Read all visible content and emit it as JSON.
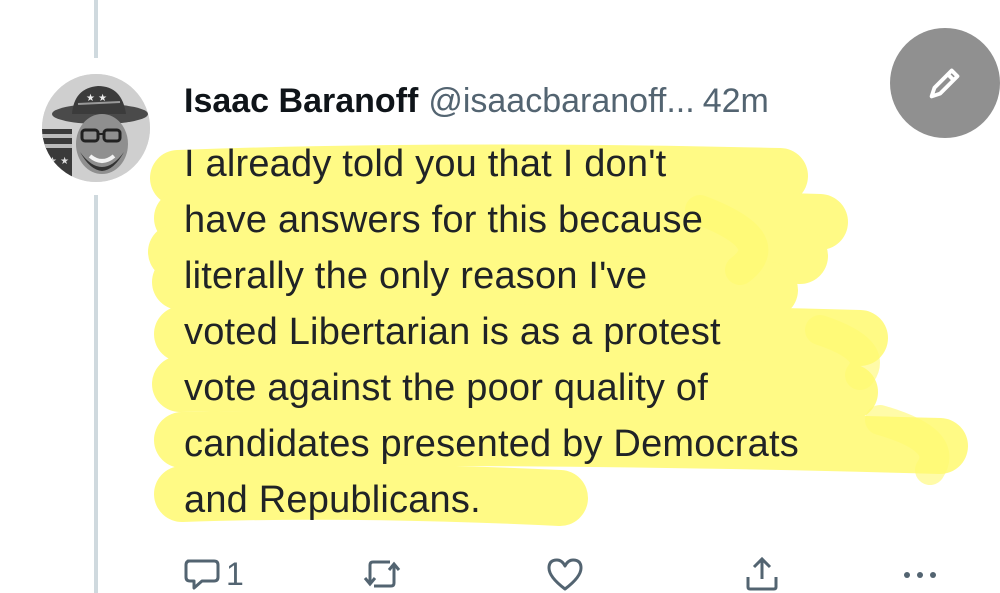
{
  "tweet": {
    "author": {
      "display_name": "Isaac Baranoff",
      "handle": "@isaacbaranoff...",
      "avatar_icon": "avatar-cowboy-hat-photo"
    },
    "timestamp": "42m",
    "text_lines": [
      "I already told you that I don't",
      "have answers for this because",
      "literally the only reason I've",
      "voted Libertarian is as a protest",
      "vote against the poor quality of",
      "candidates presented by Democrats",
      "and Republicans."
    ],
    "actions": {
      "reply_count": "1",
      "reply_icon": "reply-icon",
      "retweet_icon": "retweet-icon",
      "like_icon": "heart-icon",
      "share_icon": "share-icon",
      "more_icon": "more-icon"
    }
  },
  "compose_button": {
    "icon": "pencil-icon"
  },
  "colors": {
    "highlight": "#fffa70",
    "thread_line": "#cfd9de",
    "secondary_text": "#536471",
    "primary_text": "#0f1419"
  }
}
